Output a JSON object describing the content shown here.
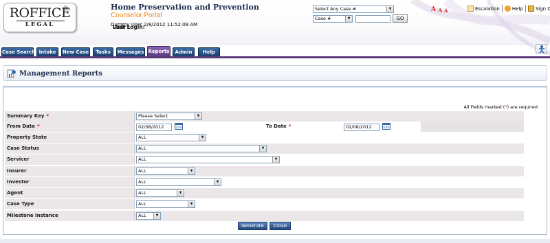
{
  "logo": {
    "main": "ROFFICE",
    "reg": "®",
    "sub": "LEGAL"
  },
  "header": {
    "title": "Home Preservation and Prevention",
    "subtitle": "Counselor Portal",
    "user_label": "User :",
    "user_value": "Dummy User",
    "last_login_label": "Last Login:",
    "last_login_value": "2/8/2012 11:52:09 AM"
  },
  "search": {
    "case_select": "Select Any Case #",
    "field_select": "Case #",
    "input_value": "",
    "go_label": "GO"
  },
  "font_sizer": {
    "small": "A",
    "medium": "A",
    "large": "A"
  },
  "top_links": {
    "escalation": "Escalation",
    "help": "Help",
    "sign_out": "Sign Out"
  },
  "nav": {
    "tabs": [
      {
        "label": "Case Search",
        "active": false
      },
      {
        "label": "Intake",
        "active": false
      },
      {
        "label": "New Case",
        "active": false
      },
      {
        "label": "Tasks",
        "active": false
      },
      {
        "label": "Messages",
        "active": false
      },
      {
        "label": "Reports",
        "active": true
      },
      {
        "label": "Admin",
        "active": false
      },
      {
        "label": "Help",
        "active": false
      }
    ]
  },
  "page": {
    "title": "Management Reports"
  },
  "form": {
    "required_note_prefix": "All Fields marked (",
    "required_note_star": "*",
    "required_note_suffix": ") are required",
    "fields": {
      "summary_key": {
        "label": "Summary Key",
        "required": "*",
        "value": "Please Select"
      },
      "from_date": {
        "label": "From Date",
        "required": "*",
        "value": "02/08/2012"
      },
      "to_date": {
        "label": "To Date",
        "required": "*",
        "value": "02/08/2012"
      },
      "property_state": {
        "label": "Property State",
        "value": "ALL"
      },
      "case_status": {
        "label": "Case Status",
        "value": "ALL"
      },
      "servicer": {
        "label": "Servicer",
        "value": "ALL"
      },
      "insurer": {
        "label": "Insurer",
        "value": "ALL"
      },
      "investor": {
        "label": "Investor",
        "value": "ALL"
      },
      "agent": {
        "label": "Agent",
        "value": "ALL"
      },
      "case_type": {
        "label": "Case Type",
        "value": "ALL"
      },
      "milestone_instance": {
        "label": "Milestone Instance",
        "value": "ALL"
      }
    },
    "generate_label": "Generate",
    "close_label": "Close"
  },
  "colors": {
    "brand_navy": "#1f2d4f",
    "accent_orange": "#f08a1e",
    "tab_blue": "#24497e",
    "tab_active_purple": "#5b3d82",
    "required_red": "#cc0000"
  }
}
